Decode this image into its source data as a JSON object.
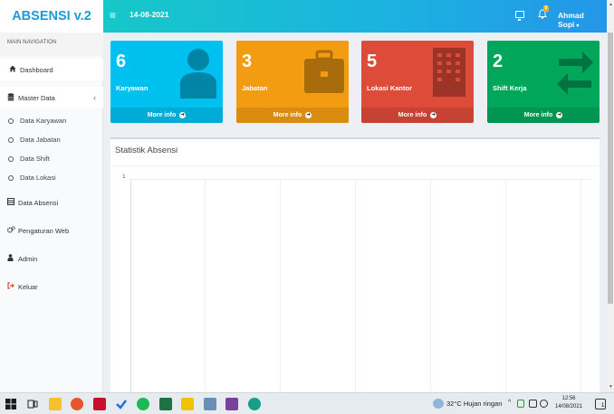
{
  "app": {
    "logo": "ABSENSI v.2"
  },
  "header": {
    "menu_icon": "≡",
    "date": "14-08-2021",
    "notif_count": "0",
    "user_name": "Ahmad Sopi",
    "caret": "▾"
  },
  "sidebar": {
    "header": "MAIN NAVIGATION",
    "items": [
      {
        "label": "Dashboard",
        "icon": "home-icon"
      },
      {
        "label": "Master Data",
        "icon": "database-icon"
      },
      {
        "label": "Data Absensi",
        "icon": "list-icon"
      },
      {
        "label": "Pengaturan Web",
        "icon": "cogs-icon"
      },
      {
        "label": "Admin",
        "icon": "user-icon"
      },
      {
        "label": "Keluar",
        "icon": "sign-out-icon"
      }
    ],
    "master_chevron": "‹",
    "submenu": [
      {
        "label": "Data Karyawan"
      },
      {
        "label": "Data Jabatan"
      },
      {
        "label": "Data Shift"
      },
      {
        "label": "Data Lokasi"
      }
    ]
  },
  "stats": [
    {
      "count": "6",
      "label": "Karyawan",
      "footer": "More info",
      "color": "#00c0ef",
      "icon": "user-icon"
    },
    {
      "count": "3",
      "label": "Jabatan",
      "footer": "More info",
      "color": "#f39c12",
      "icon": "briefcase-icon"
    },
    {
      "count": "5",
      "label": "Lokasi Kantor",
      "footer": "More info",
      "color": "#dd4b39",
      "icon": "building-icon"
    },
    {
      "count": "2",
      "label": "Shift Kerja",
      "footer": "More info",
      "color": "#00a65a",
      "icon": "refresh-icon"
    }
  ],
  "chart_panel": {
    "title": "Statistik Absensi",
    "y_tick": "1"
  },
  "taskbar": {
    "weather": "32°C  Hujan ringan",
    "time": "12:56",
    "date": "14/08/2021",
    "notif": "1"
  }
}
